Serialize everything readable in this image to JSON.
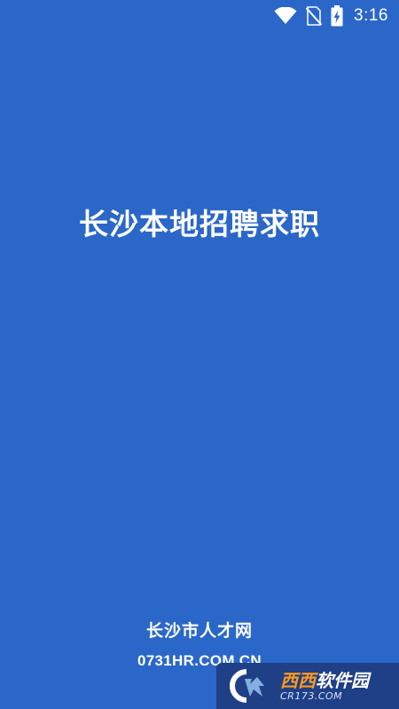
{
  "status_bar": {
    "time": "3:16",
    "icons": [
      "wifi-icon",
      "no-sim-icon",
      "battery-charging-icon"
    ]
  },
  "splash": {
    "title": "长沙本地招聘求职",
    "brand_name": "长沙市人才网",
    "domain": "0731HR.COM.CN"
  },
  "watermark": {
    "name_part1": "西西",
    "name_part2": "软件园",
    "url": "CR173.COM"
  },
  "colors": {
    "background": "#2b67c8",
    "text": "#ffffff",
    "watermark_bg": "#1f3f86",
    "watermark_accent": "#ff9a1c"
  }
}
